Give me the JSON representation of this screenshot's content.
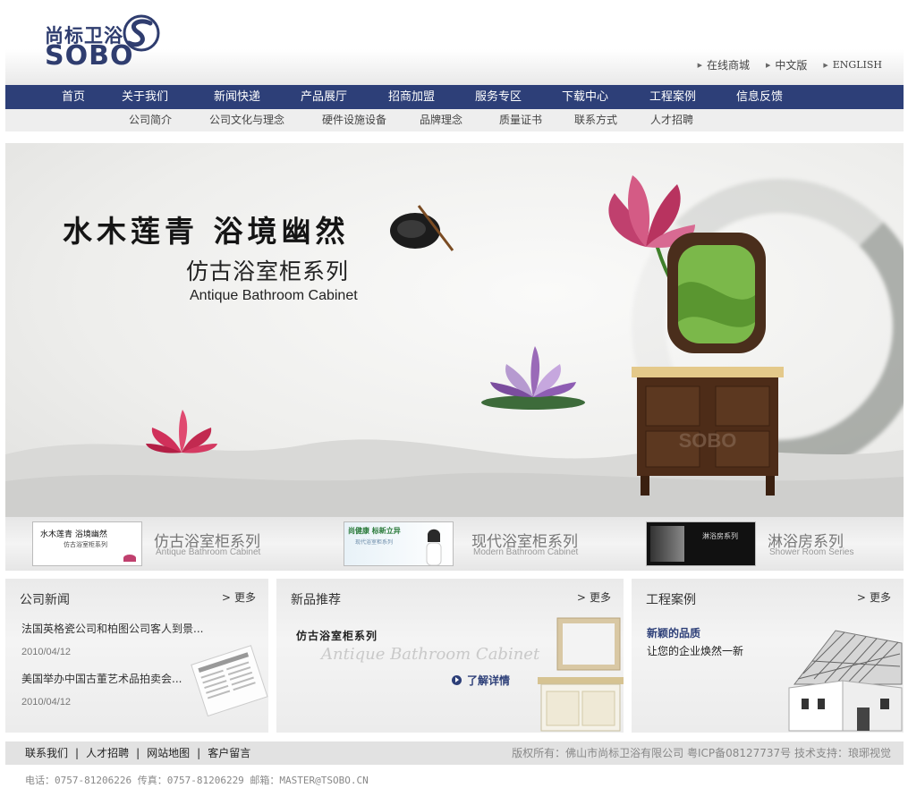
{
  "brand": {
    "name_cn": "尚标卫浴",
    "name_en": "SOBO"
  },
  "top_links": [
    "在线商城",
    "中文版",
    "ENGLISH"
  ],
  "main_nav": [
    "首页",
    "关于我们",
    "新闻快递",
    "产品展厅",
    "招商加盟",
    "服务专区",
    "下载中心",
    "工程案例",
    "信息反馈"
  ],
  "sub_nav": [
    "公司简介",
    "公司文化与理念",
    "硬件设施设备",
    "品牌理念",
    "质量证书",
    "联系方式",
    "人才招聘"
  ],
  "banner": {
    "poem": "水木莲青 浴境幽然",
    "series_cn": "仿古浴室柜系列",
    "series_en": "Antique Bathroom Cabinet",
    "cabinet_watermark": "SOBO"
  },
  "series": [
    {
      "title": "仿古浴室柜系列",
      "subtitle": "Antique Bathroom Cabinet",
      "thumb_text": "水木莲青 浴境幽然",
      "thumb_sub": "仿古浴室柜系列"
    },
    {
      "title": "现代浴室柜系列",
      "subtitle": "Modern Bathroom Cabinet",
      "thumb_text": "尚健康 标新立异",
      "thumb_sub": "现代浴室柜系列"
    },
    {
      "title": "淋浴房系列",
      "subtitle": "Shower Room Series",
      "thumb_text": "淋浴房系列",
      "thumb_sub": ""
    }
  ],
  "news": {
    "title": "公司新闻",
    "more": "更多",
    "items": [
      {
        "title": "法国英格瓷公司和柏图公司客人到景...",
        "date": "2010/04/12"
      },
      {
        "title": "美国举办中国古董艺术品拍卖会...",
        "date": "2010/04/12"
      }
    ]
  },
  "products": {
    "title": "新品推荐",
    "more": "更多",
    "item_title": "仿古浴室柜系列",
    "item_en": "Antique Bathroom Cabinet",
    "detail": "了解详情"
  },
  "cases": {
    "title": "工程案例",
    "more": "更多",
    "headline": "新颖的品质",
    "text": "让您的企业焕然一新"
  },
  "footer": {
    "links": [
      "联系我们",
      "人才招聘",
      "网站地图",
      "客户留言"
    ],
    "copyright": "版权所有：佛山市尚标卫浴有限公司 粤ICP备08127737号 技术支持：琅琊视觉",
    "contact": "电话：0757-81206226 传真：0757-81206229 邮箱：MASTER@TSOBO.CN"
  },
  "colors": {
    "nav_bg": "#2d3f78",
    "brand_blue": "#2f3d6f",
    "subnav_bg": "#eeeeee"
  }
}
